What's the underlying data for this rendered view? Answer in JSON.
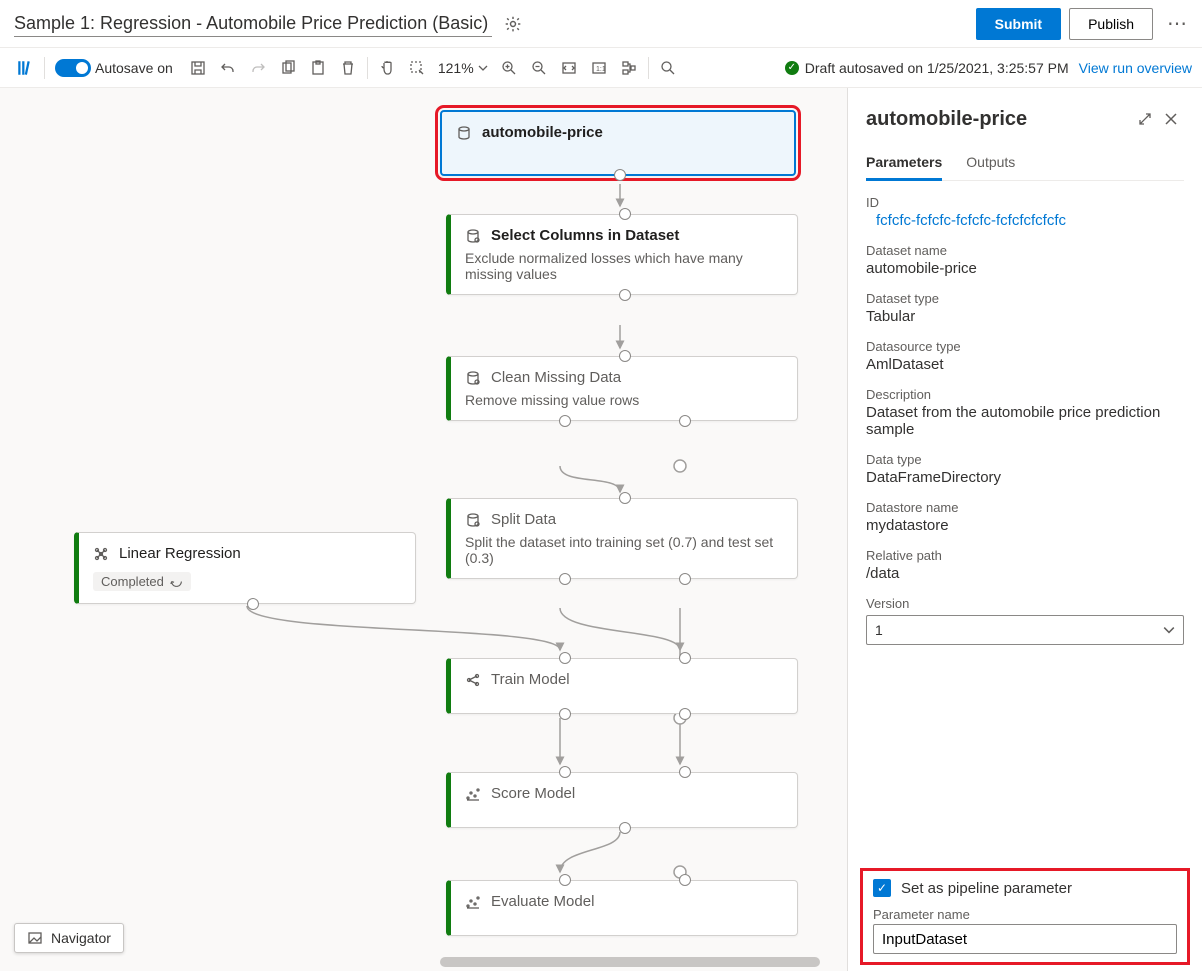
{
  "header": {
    "title": "Sample 1: Regression - Automobile Price Prediction (Basic)",
    "submit": "Submit",
    "publish": "Publish"
  },
  "toolbar": {
    "autosave": "Autosave on",
    "zoom": "121%",
    "draft_status": "Draft autosaved on 1/25/2021, 3:25:57 PM",
    "view_run": "View run overview"
  },
  "navigator": "Navigator",
  "nodes": {
    "n1": {
      "title": "automobile-price"
    },
    "n2": {
      "title": "Select Columns in Dataset",
      "desc": "Exclude normalized losses which have many missing values"
    },
    "n3": {
      "title": "Clean Missing Data",
      "desc": "Remove missing value rows"
    },
    "n4": {
      "title": "Split Data",
      "desc": "Split the dataset into training set (0.7) and test set (0.3)"
    },
    "n5": {
      "title": "Linear Regression",
      "status": "Completed"
    },
    "n6": {
      "title": "Train Model"
    },
    "n7": {
      "title": "Score Model"
    },
    "n8": {
      "title": "Evaluate Model"
    }
  },
  "panel": {
    "title": "automobile-price",
    "tabs": {
      "t1": "Parameters",
      "t2": "Outputs"
    },
    "id_label": "ID",
    "id_value": "fcfcfc-fcfcfc-fcfcfc-fcfcfcfcfcfc",
    "dataset_name_label": "Dataset name",
    "dataset_name": "automobile-price",
    "dataset_type_label": "Dataset type",
    "dataset_type": "Tabular",
    "datasource_type_label": "Datasource type",
    "datasource_type": "AmlDataset",
    "description_label": "Description",
    "description": "Dataset from the automobile price prediction sample",
    "data_type_label": "Data type",
    "data_type": "DataFrameDirectory",
    "datastore_label": "Datastore name",
    "datastore": "mydatastore",
    "relpath_label": "Relative path",
    "relpath": "/data",
    "version_label": "Version",
    "version": "1",
    "pipeline_param_label": "Set as pipeline parameter",
    "param_name_label": "Parameter name",
    "param_name_value": "InputDataset"
  }
}
